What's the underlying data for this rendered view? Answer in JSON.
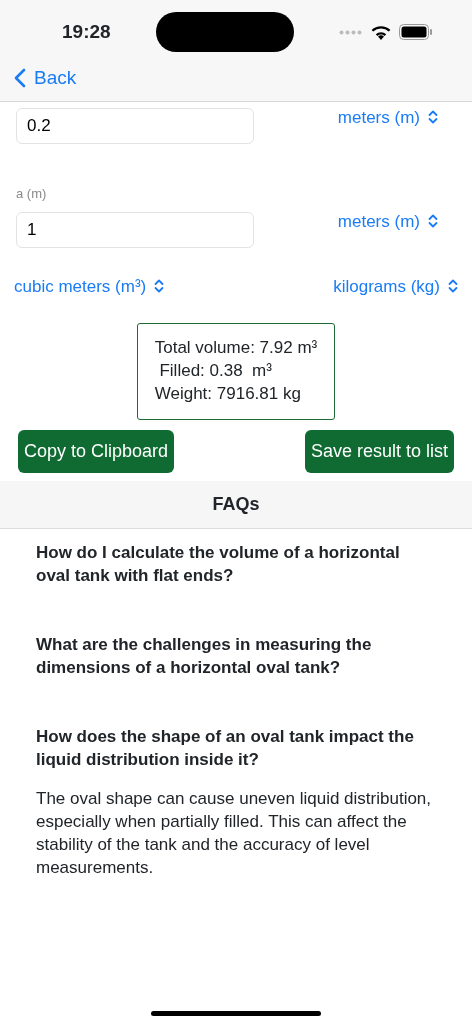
{
  "status_bar": {
    "time": "19:28"
  },
  "nav": {
    "back": "Back"
  },
  "inputs": [
    {
      "value": "0.2",
      "unit": "meters (m)"
    },
    {
      "label": "a (m)",
      "value": "1",
      "unit": "meters (m)"
    }
  ],
  "output_units": [
    "cubic meters (m³)",
    "kilograms (kg)"
  ],
  "result": [
    "Total volume: 7.92 m³",
    " Filled: 0.38  m³",
    "Weight: 7916.81 kg"
  ],
  "buttons": [
    "Copy to Clipboard",
    "Save result to list"
  ],
  "faq": {
    "title": "FAQs",
    "items": [
      {
        "question": "How do I calculate the volume of a horizontal oval tank with flat ends?"
      },
      {
        "question": "What are the challenges in measuring the dimensions of a horizontal oval tank?"
      },
      {
        "question": "How does the shape of an oval tank impact the liquid distribution inside it?",
        "answer": "The oval shape can cause uneven liquid distribution, especially when partially filled. This can affect the stability of the tank and the accuracy of level measurements."
      }
    ]
  }
}
